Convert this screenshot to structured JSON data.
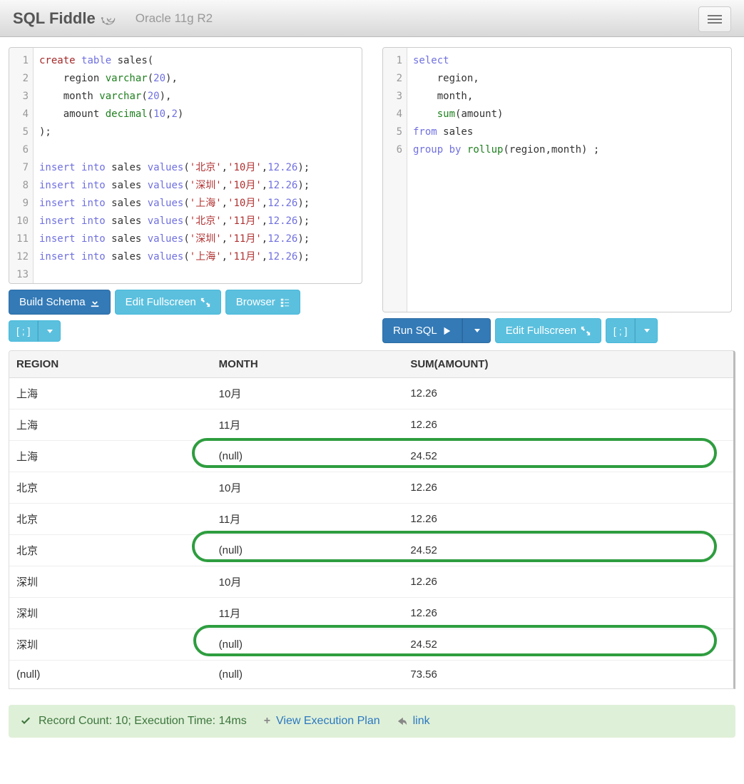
{
  "header": {
    "brand": "SQL Fiddle",
    "db_version": "Oracle 11g R2"
  },
  "schema_editor": {
    "lines": [
      {
        "n": 1,
        "html": "<span class='kw-ddl'>create</span> <span class='kw-blue'>table</span> sales("
      },
      {
        "n": 2,
        "html": "    region <span class='kw-type'>varchar</span>(<span class='num'>20</span>),"
      },
      {
        "n": 3,
        "html": "    month <span class='kw-type'>varchar</span>(<span class='num'>20</span>),"
      },
      {
        "n": 4,
        "html": "    amount <span class='kw-type'>decimal</span>(<span class='num'>10</span>,<span class='num'>2</span>)"
      },
      {
        "n": 5,
        "html": ");"
      },
      {
        "n": 6,
        "html": ""
      },
      {
        "n": 7,
        "html": "<span class='kw-blue'>insert</span> <span class='kw-blue'>into</span> sales <span class='kw-blue'>values</span>(<span class='str'>'北京'</span>,<span class='str'>'10月'</span>,<span class='num'>12.26</span>);"
      },
      {
        "n": 8,
        "html": "<span class='kw-blue'>insert</span> <span class='kw-blue'>into</span> sales <span class='kw-blue'>values</span>(<span class='str'>'深圳'</span>,<span class='str'>'10月'</span>,<span class='num'>12.26</span>);"
      },
      {
        "n": 9,
        "html": "<span class='kw-blue'>insert</span> <span class='kw-blue'>into</span> sales <span class='kw-blue'>values</span>(<span class='str'>'上海'</span>,<span class='str'>'10月'</span>,<span class='num'>12.26</span>);"
      },
      {
        "n": 10,
        "html": "<span class='kw-blue'>insert</span> <span class='kw-blue'>into</span> sales <span class='kw-blue'>values</span>(<span class='str'>'北京'</span>,<span class='str'>'11月'</span>,<span class='num'>12.26</span>);"
      },
      {
        "n": 11,
        "html": "<span class='kw-blue'>insert</span> <span class='kw-blue'>into</span> sales <span class='kw-blue'>values</span>(<span class='str'>'深圳'</span>,<span class='str'>'11月'</span>,<span class='num'>12.26</span>);"
      },
      {
        "n": 12,
        "html": "<span class='kw-blue'>insert</span> <span class='kw-blue'>into</span> sales <span class='kw-blue'>values</span>(<span class='str'>'上海'</span>,<span class='str'>'11月'</span>,<span class='num'>12.26</span>);"
      },
      {
        "n": 13,
        "html": ""
      }
    ]
  },
  "query_editor": {
    "lines": [
      {
        "n": 1,
        "html": "<span class='kw-blue'>select</span>"
      },
      {
        "n": 2,
        "html": "    region,"
      },
      {
        "n": 3,
        "html": "    month,"
      },
      {
        "n": 4,
        "html": "    <span class='kw-type'>sum</span>(amount)"
      },
      {
        "n": 5,
        "html": "<span class='kw-blue'>from</span> sales"
      },
      {
        "n": 6,
        "html": "<span class='kw-blue'>group</span> <span class='kw-blue'>by</span> <span class='kw-type'>rollup</span>(region,month) ;"
      }
    ]
  },
  "buttons": {
    "build_schema": "Build Schema",
    "edit_fullscreen": "Edit Fullscreen",
    "browser": "Browser",
    "terminator": "[ ; ]",
    "run_sql": "Run SQL"
  },
  "results": {
    "columns": [
      "REGION",
      "MONTH",
      "SUM(AMOUNT)"
    ],
    "rows": [
      {
        "region": "上海",
        "month": "10月",
        "sum": "12.26",
        "highlight": 0
      },
      {
        "region": "上海",
        "month": "11月",
        "sum": "12.26",
        "highlight": 0
      },
      {
        "region": "上海",
        "month": "(null)",
        "sum": "24.52",
        "highlight": 1
      },
      {
        "region": "北京",
        "month": "10月",
        "sum": "12.26",
        "highlight": 0
      },
      {
        "region": "北京",
        "month": "11月",
        "sum": "12.26",
        "highlight": 0
      },
      {
        "region": "北京",
        "month": "(null)",
        "sum": "24.52",
        "highlight": 2
      },
      {
        "region": "深圳",
        "month": "10月",
        "sum": "12.26",
        "highlight": 0
      },
      {
        "region": "深圳",
        "month": "11月",
        "sum": "12.26",
        "highlight": 0
      },
      {
        "region": "深圳",
        "month": "(null)",
        "sum": "24.52",
        "highlight": 3
      },
      {
        "region": "(null)",
        "month": "(null)",
        "sum": "73.56",
        "highlight": 0
      }
    ]
  },
  "status": {
    "text": "Record Count: 10; Execution Time: 14ms",
    "plan_link": "View Execution Plan",
    "link": "link"
  }
}
